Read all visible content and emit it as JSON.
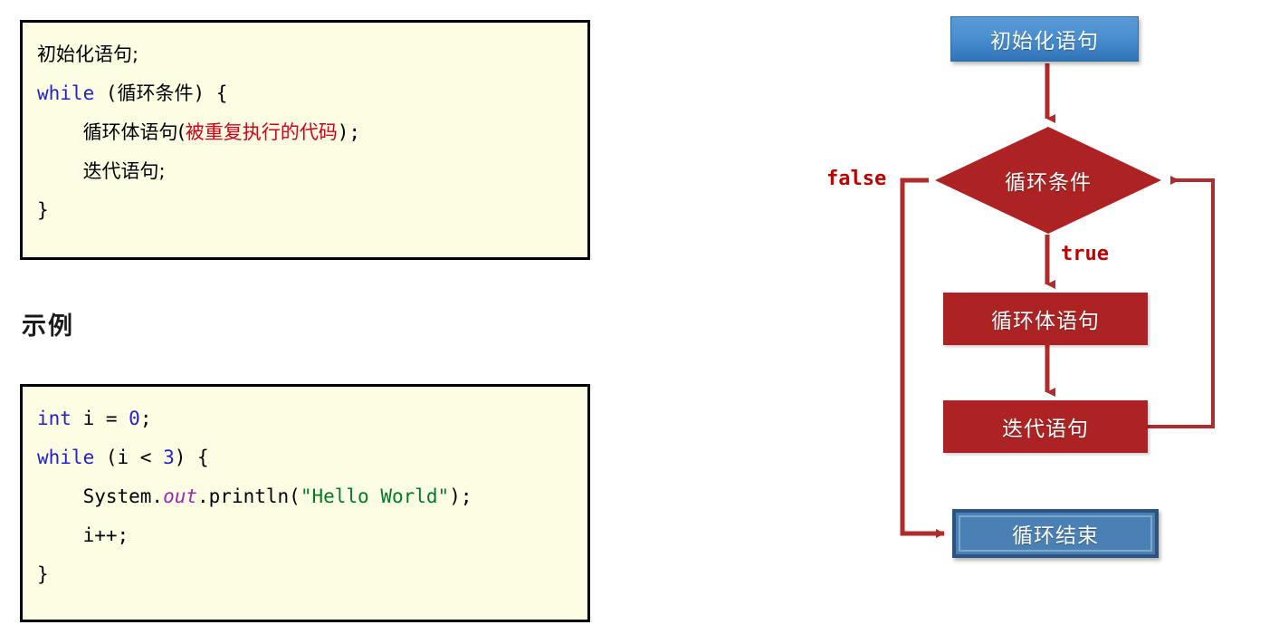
{
  "code_syntax": {
    "title": "while loop syntax",
    "lines": [
      {
        "id": "l1",
        "indent": 0,
        "parts": [
          {
            "text": "初始化语句;",
            "style": "cjk-plain"
          }
        ]
      },
      {
        "id": "l2",
        "indent": 0,
        "parts": [
          {
            "text": "while",
            "style": "kw"
          },
          {
            "text": " (",
            "style": "plain"
          },
          {
            "text": "循环条件",
            "style": "cjk-plain"
          },
          {
            "text": ") {",
            "style": "plain"
          }
        ]
      },
      {
        "id": "l3",
        "indent": 1,
        "parts": [
          {
            "text": "循环体语句(",
            "style": "cjk-plain"
          },
          {
            "text": "被重复执行的代码",
            "style": "cjk-red"
          },
          {
            "text": ");",
            "style": "plain"
          }
        ]
      },
      {
        "id": "l4",
        "indent": 1,
        "parts": [
          {
            "text": "迭代语句;",
            "style": "cjk-plain"
          }
        ]
      },
      {
        "id": "l5",
        "indent": 0,
        "parts": [
          {
            "text": "}",
            "style": "plain"
          }
        ]
      }
    ]
  },
  "example_heading": "示例",
  "code_example": {
    "title": "while loop example",
    "lines": [
      {
        "id": "e1",
        "indent": 0,
        "parts": [
          {
            "text": "int",
            "style": "kw"
          },
          {
            "text": " i = ",
            "style": "plain"
          },
          {
            "text": "0",
            "style": "num"
          },
          {
            "text": ";",
            "style": "plain"
          }
        ]
      },
      {
        "id": "e2",
        "indent": 0,
        "parts": [
          {
            "text": "while",
            "style": "kw"
          },
          {
            "text": " (i < ",
            "style": "plain"
          },
          {
            "text": "3",
            "style": "num"
          },
          {
            "text": ") {",
            "style": "plain"
          }
        ]
      },
      {
        "id": "e3",
        "indent": 1,
        "parts": [
          {
            "text": "System.",
            "style": "plain"
          },
          {
            "text": "out",
            "style": "field"
          },
          {
            "text": ".println(",
            "style": "plain"
          },
          {
            "text": "\"Hello World\"",
            "style": "str"
          },
          {
            "text": ");",
            "style": "plain"
          }
        ]
      },
      {
        "id": "e4",
        "indent": 1,
        "parts": [
          {
            "text": "i++;",
            "style": "plain"
          }
        ]
      },
      {
        "id": "e5",
        "indent": 0,
        "parts": [
          {
            "text": "}",
            "style": "plain"
          }
        ]
      }
    ]
  },
  "flowchart": {
    "nodes": {
      "start": "初始化语句",
      "condition": "循环条件",
      "body": "循环体语句",
      "iterate": "迭代语句",
      "end": "循环结束"
    },
    "labels": {
      "false": "false",
      "true": "true"
    },
    "colors": {
      "start_fill_top": "#5b9bd5",
      "start_fill_bottom": "#2f74b8",
      "process_fill": "#ad2323",
      "diamond_fill": "#ad2323",
      "end_fill": "#4a80b4",
      "end_border": "#2b5580",
      "connector": "#b02b2b",
      "label_text": "#c00000"
    }
  },
  "theme": {
    "code_bg": "#fdfde3",
    "code_border": "#000000",
    "keyword_color": "#2222cc",
    "string_color": "#007a29",
    "field_color": "#9c27b0",
    "highlight_color": "#d0021b"
  }
}
